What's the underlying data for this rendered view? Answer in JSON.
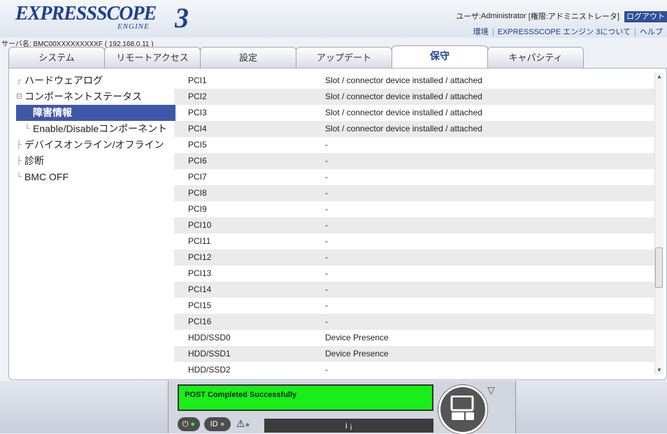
{
  "header": {
    "logo_main": "EXPRESSSCOPE",
    "logo_sub": "ENGINE",
    "logo_num": "3",
    "user_label": "ユーザ:",
    "user_name": "Administrator",
    "role": "[権限:アドミニストレータ]",
    "logout": "ログアウト",
    "links": [
      "環境",
      "EXPRESSSCOPE エンジン 3について",
      "ヘルプ"
    ],
    "server": "サーバ名: BMC00XXXXXXXXXF ( 192.168.0.11 )"
  },
  "tabs": [
    "システム",
    "リモートアクセス",
    "設定",
    "アップデート",
    "保守",
    "キャパシティ"
  ],
  "active_tab": "保守",
  "tree": [
    {
      "label": "ハードウェアログ",
      "level": 1
    },
    {
      "label": "コンポーネントステータス",
      "level": 1
    },
    {
      "label": "障害情報",
      "level": 2,
      "selected": true
    },
    {
      "label": "Enable/Disableコンポーネント",
      "level": 2
    },
    {
      "label": "デバイスオンライン/オフライン",
      "level": 1
    },
    {
      "label": "診断",
      "level": 1
    },
    {
      "label": "BMC OFF",
      "level": 1
    }
  ],
  "table_rows": [
    [
      "PCI1",
      "Slot / connector device installed / attached"
    ],
    [
      "PCI2",
      "Slot / connector device installed / attached"
    ],
    [
      "PCI3",
      "Slot / connector device installed / attached"
    ],
    [
      "PCI4",
      "Slot / connector device installed / attached"
    ],
    [
      "PCI5",
      "-"
    ],
    [
      "PCI6",
      "-"
    ],
    [
      "PCI7",
      "-"
    ],
    [
      "PCI8",
      "-"
    ],
    [
      "PCI9",
      "-"
    ],
    [
      "PCI10",
      "-"
    ],
    [
      "PCI11",
      "-"
    ],
    [
      "PCI12",
      "-"
    ],
    [
      "PCI13",
      "-"
    ],
    [
      "PCI14",
      "-"
    ],
    [
      "PCI15",
      "-"
    ],
    [
      "PCI16",
      "-"
    ],
    [
      "HDD/SSD0",
      "Device Presence"
    ],
    [
      "HDD/SSD1",
      "Device Presence"
    ],
    [
      "HDD/SSD2",
      "-"
    ]
  ],
  "status": {
    "lcd_text": "POST Completed Successfully",
    "power_label": "⏻",
    "id_label": "ID",
    "warn_label": "⚠",
    "info_label": "i ¡"
  },
  "colors": {
    "accent": "#1b3f93",
    "selected": "#3f57a8",
    "lcd": "#19ee19"
  }
}
